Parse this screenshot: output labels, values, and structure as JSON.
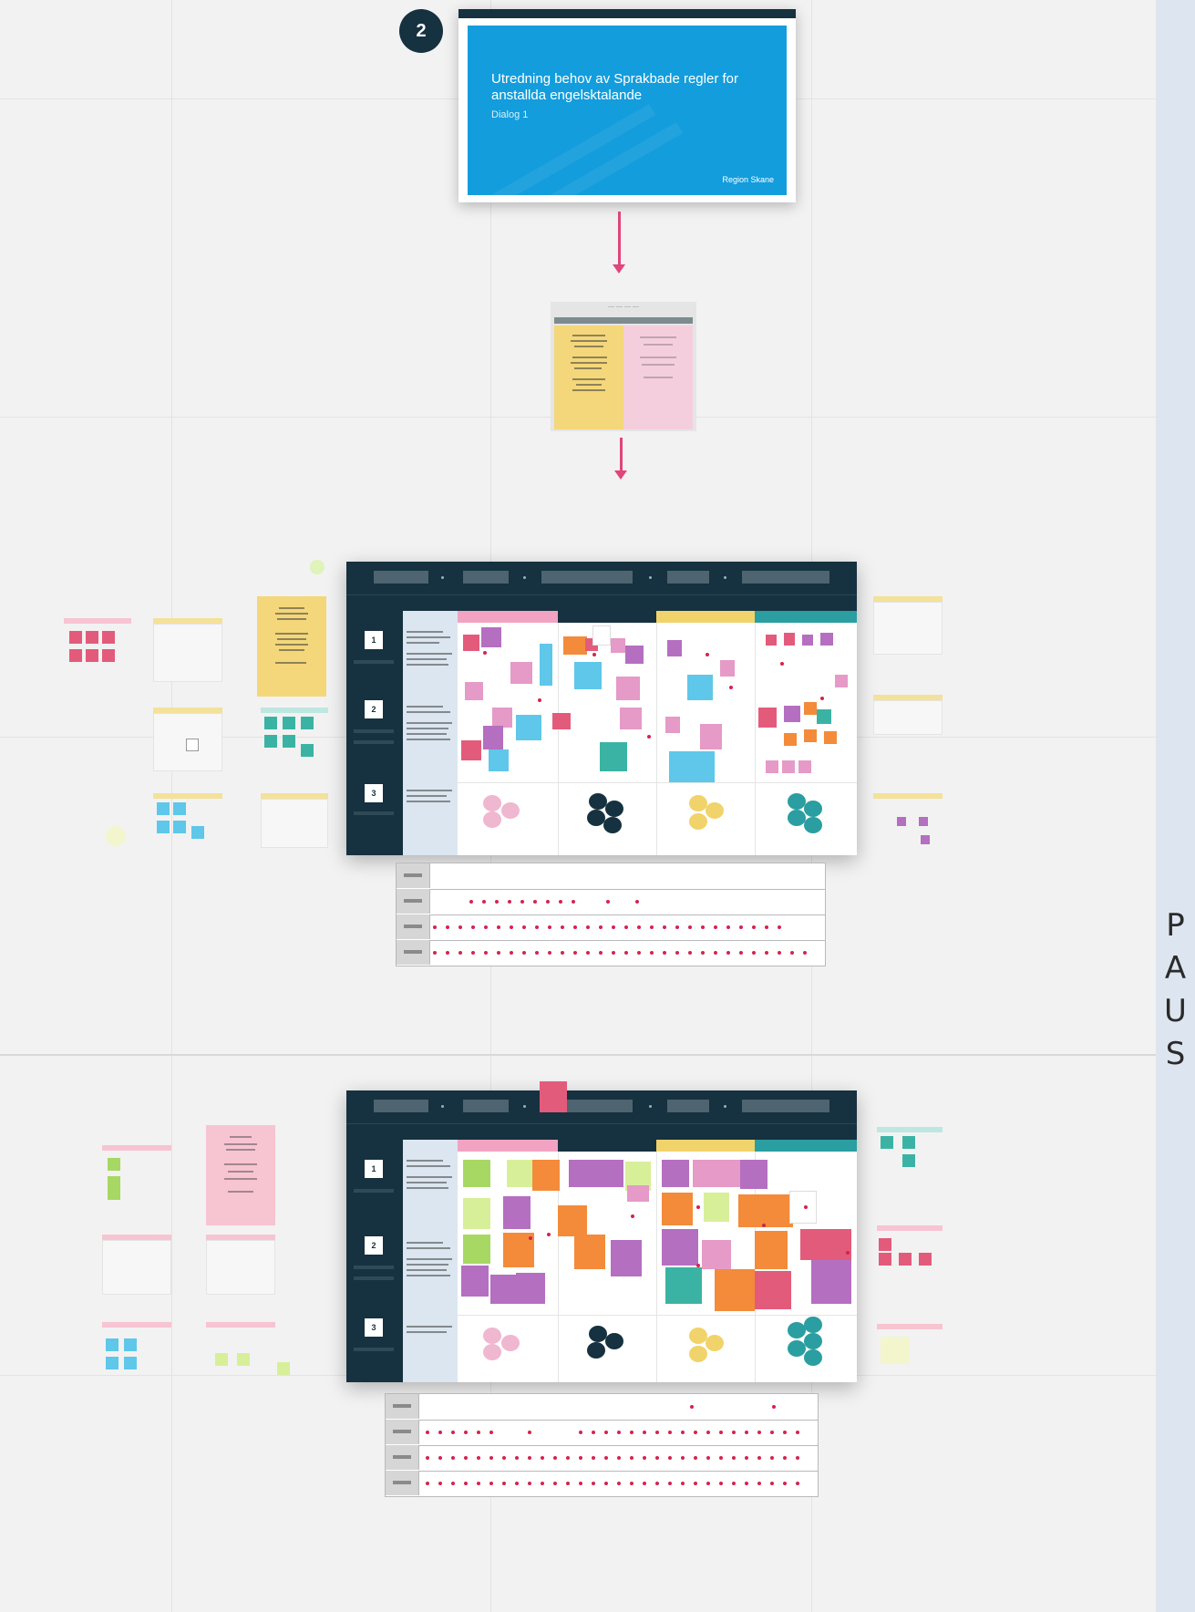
{
  "canvas": {
    "right_panel_label": "P\nA\nU\nS",
    "background": "#f2f2f2"
  },
  "step_badge": "2",
  "title_slide": {
    "title": "Utredning behov av Sprakbade regler for anstallda engelsktalande",
    "subtitle": "Dialog 1",
    "logo": "Region Skane",
    "color": "#139ddc"
  },
  "boards": [
    {
      "name": "board-1",
      "rows": [
        "1",
        "2",
        "3"
      ]
    },
    {
      "name": "board-2",
      "rows": [
        "1",
        "2",
        "3"
      ]
    }
  ],
  "colors": {
    "dark": "#16313f",
    "pink": "#e35b7b",
    "magenta": "#e59ac7",
    "purple": "#b46fc0",
    "cyan": "#5ec7ea",
    "orange": "#f38b3a",
    "green": "#a6d863",
    "teal": "#3bb3a4",
    "yellow": "#f4d77a",
    "vote": "#d4234f"
  }
}
